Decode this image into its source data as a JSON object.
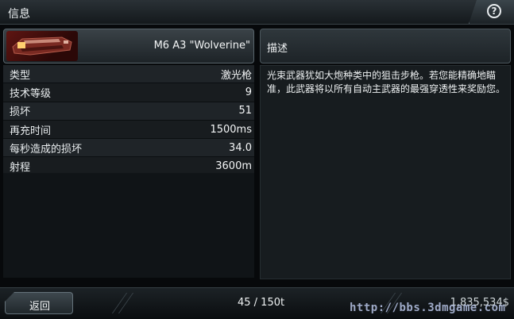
{
  "window": {
    "title": "信息"
  },
  "help": {
    "icon": "question-circle-icon",
    "glyph": "?"
  },
  "weapon": {
    "name": "M6 A3 \"Wolverine\""
  },
  "stats": [
    {
      "label": "类型",
      "value": "激光枪"
    },
    {
      "label": "技术等级",
      "value": "9"
    },
    {
      "label": "损坏",
      "value": "51"
    },
    {
      "label": "再充时间",
      "value": "1500ms"
    },
    {
      "label": "每秒造成的损坏",
      "value": "34.0"
    },
    {
      "label": "射程",
      "value": "3600m"
    }
  ],
  "description": {
    "header": "描述",
    "text": "光束武器犹如大炮种类中的狙击步枪。若您能精确地瞄准，此武器将以所有自动主武器的最强穿透性来奖励您。"
  },
  "footer": {
    "back_label": "返回",
    "cargo": "45 / 150t",
    "credits": "1,835,534$"
  },
  "watermark": "http://bbs.3dmgame.com"
}
